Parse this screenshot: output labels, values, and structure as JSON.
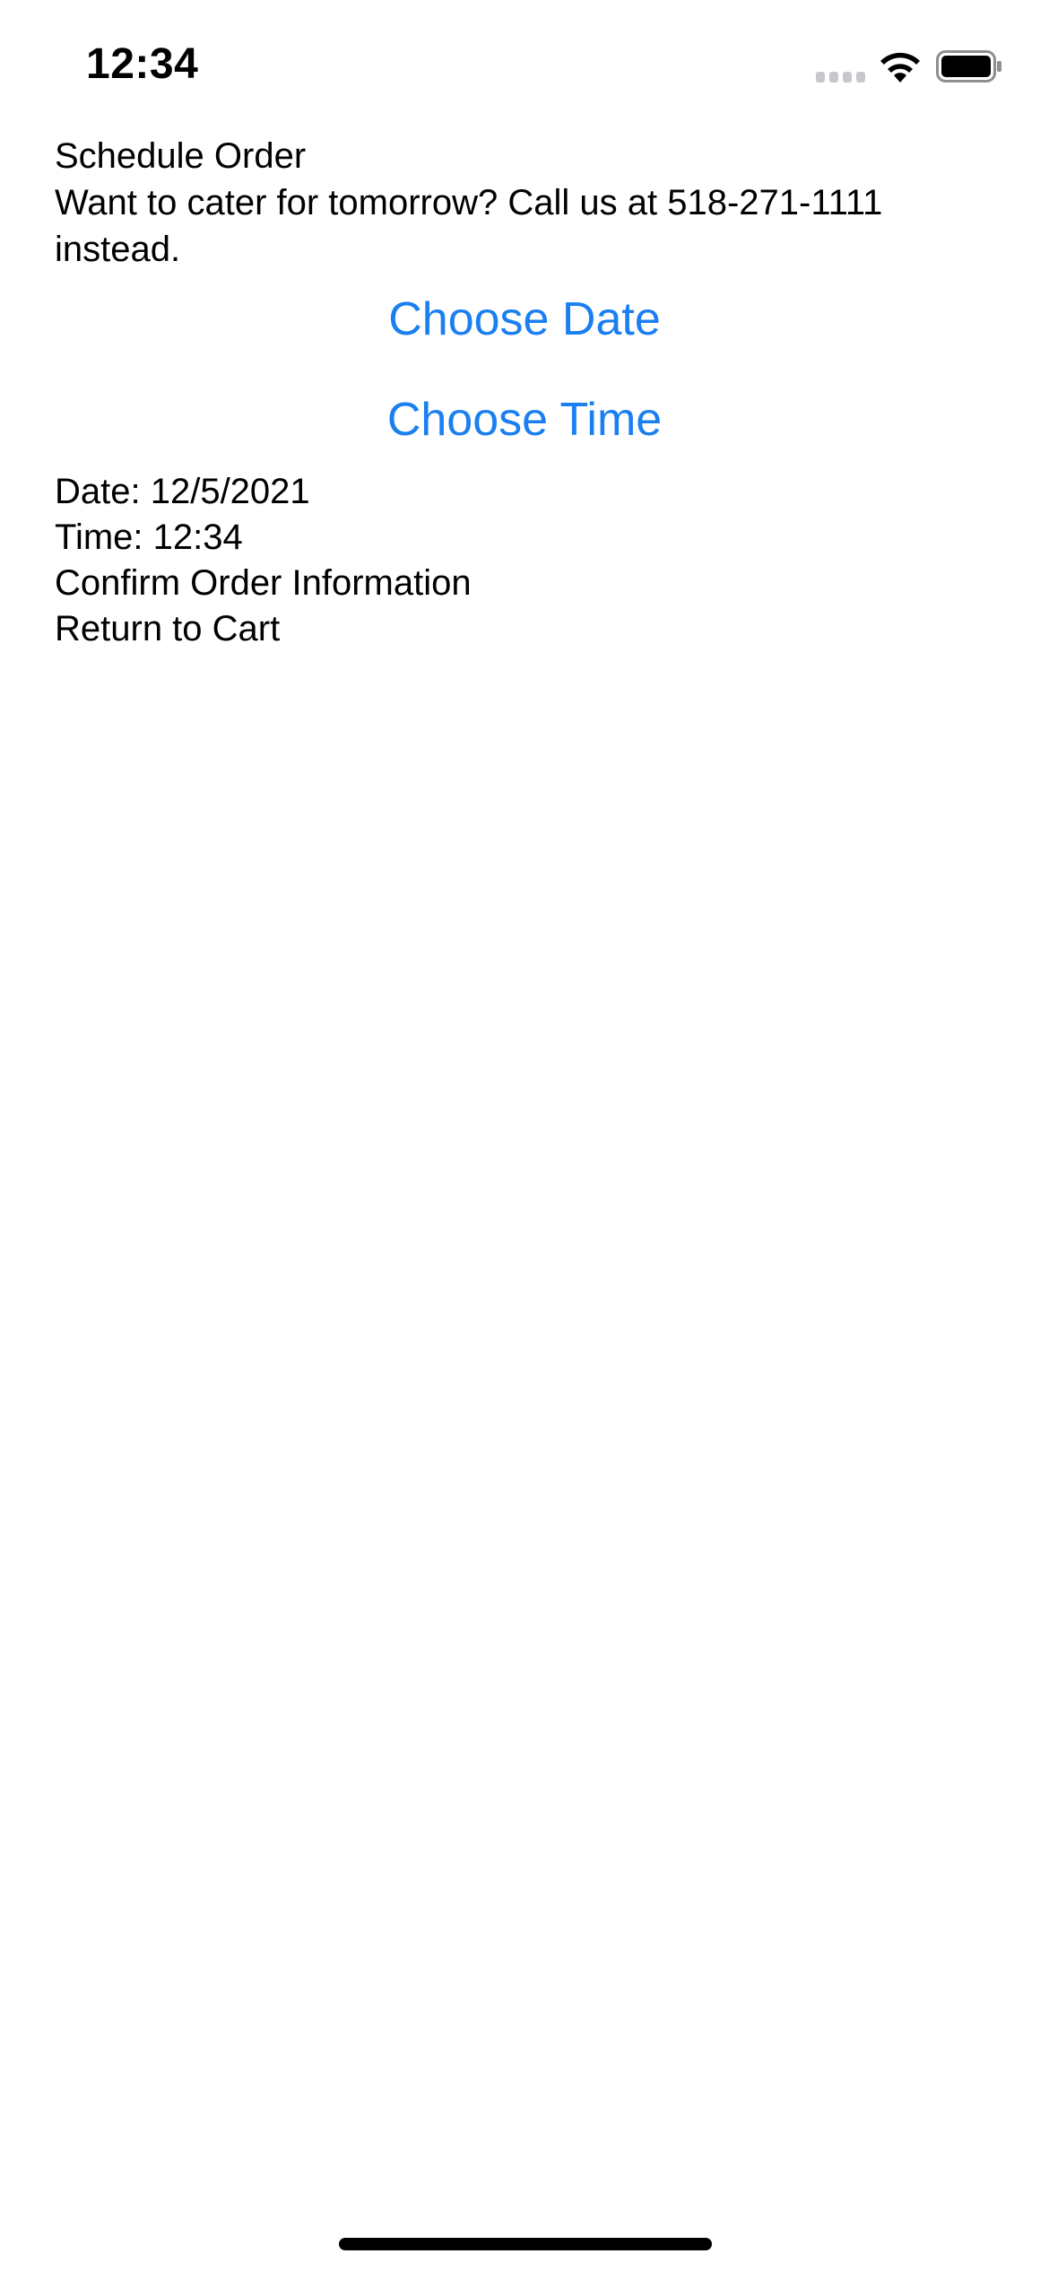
{
  "status_bar": {
    "time": "12:34",
    "icons": [
      "cellular-signal-icon",
      "wifi-icon",
      "battery-icon"
    ]
  },
  "page": {
    "title": "Schedule Order",
    "notice": "Want to cater for tomorrow? Call us at 518-271-1111 instead.",
    "choose_date_label": "Choose Date",
    "choose_time_label": "Choose Time",
    "date_text": "Date: 12/5/2021",
    "time_text": "Time: 12:34",
    "confirm_label": "Confirm Order Information",
    "return_label": "Return to Cart"
  },
  "colors": {
    "accent": "#1a7ff0",
    "text": "#000000",
    "background": "#ffffff"
  }
}
